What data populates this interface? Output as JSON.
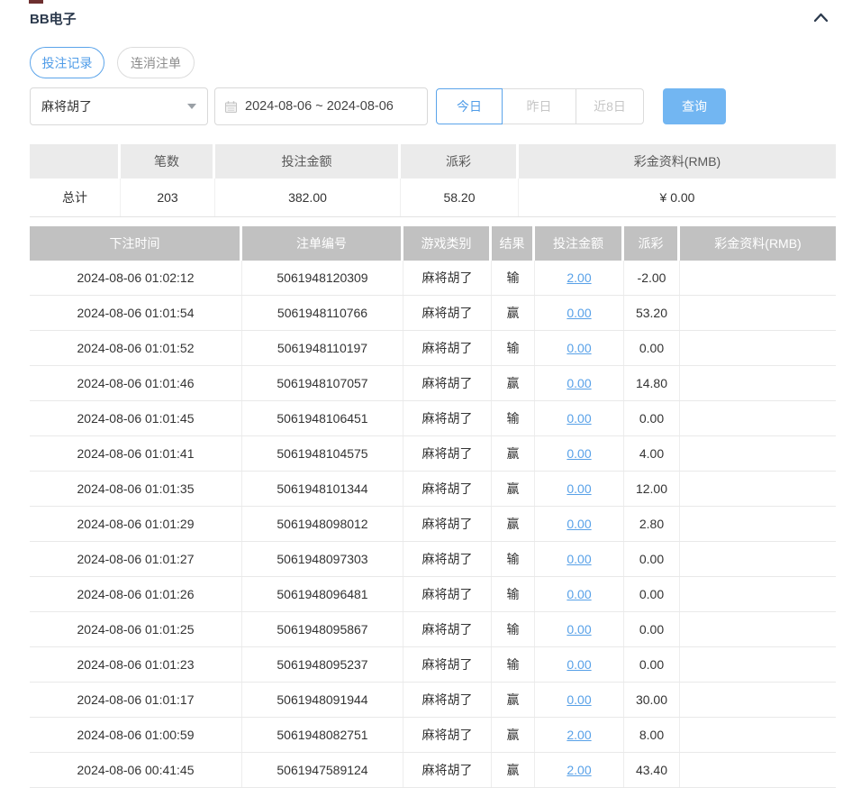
{
  "panel": {
    "title": "BB电子",
    "collapse_icon": "chevron-up"
  },
  "tabs": [
    {
      "label": "投注记录",
      "active": true
    },
    {
      "label": "连消注单",
      "active": false
    }
  ],
  "filters": {
    "game_select": {
      "value": "麻将胡了",
      "icon": "chevron-down-icon"
    },
    "date_range": {
      "value": "2024-08-06 ~ 2024-08-06",
      "icon": "calendar-icon"
    },
    "quick_buttons": [
      {
        "label": "今日",
        "active": true
      },
      {
        "label": "昨日",
        "active": false
      },
      {
        "label": "近8日",
        "active": false
      }
    ],
    "search_button": "查询"
  },
  "summary_table": {
    "headers": [
      "",
      "笔数",
      "投注金额",
      "派彩",
      "彩金资料(RMB)"
    ],
    "row": [
      "总计",
      "203",
      "382.00",
      "58.20",
      "¥ 0.00"
    ]
  },
  "main_table": {
    "headers": [
      "下注时间",
      "注单编号",
      "游戏类别",
      "结果",
      "投注金额",
      "派彩",
      "彩金资料(RMB)"
    ],
    "rows": [
      {
        "time": "2024-08-06 01:02:12",
        "order_no": "5061948120309",
        "game": "麻将胡了",
        "result": "输",
        "bet": "2.00",
        "payout": "-2.00",
        "bonus": ""
      },
      {
        "time": "2024-08-06 01:01:54",
        "order_no": "5061948110766",
        "game": "麻将胡了",
        "result": "赢",
        "bet": "0.00",
        "payout": "53.20",
        "bonus": ""
      },
      {
        "time": "2024-08-06 01:01:52",
        "order_no": "5061948110197",
        "game": "麻将胡了",
        "result": "输",
        "bet": "0.00",
        "payout": "0.00",
        "bonus": ""
      },
      {
        "time": "2024-08-06 01:01:46",
        "order_no": "5061948107057",
        "game": "麻将胡了",
        "result": "赢",
        "bet": "0.00",
        "payout": "14.80",
        "bonus": ""
      },
      {
        "time": "2024-08-06 01:01:45",
        "order_no": "5061948106451",
        "game": "麻将胡了",
        "result": "输",
        "bet": "0.00",
        "payout": "0.00",
        "bonus": ""
      },
      {
        "time": "2024-08-06 01:01:41",
        "order_no": "5061948104575",
        "game": "麻将胡了",
        "result": "赢",
        "bet": "0.00",
        "payout": "4.00",
        "bonus": ""
      },
      {
        "time": "2024-08-06 01:01:35",
        "order_no": "5061948101344",
        "game": "麻将胡了",
        "result": "赢",
        "bet": "0.00",
        "payout": "12.00",
        "bonus": ""
      },
      {
        "time": "2024-08-06 01:01:29",
        "order_no": "5061948098012",
        "game": "麻将胡了",
        "result": "赢",
        "bet": "0.00",
        "payout": "2.80",
        "bonus": ""
      },
      {
        "time": "2024-08-06 01:01:27",
        "order_no": "5061948097303",
        "game": "麻将胡了",
        "result": "输",
        "bet": "0.00",
        "payout": "0.00",
        "bonus": ""
      },
      {
        "time": "2024-08-06 01:01:26",
        "order_no": "5061948096481",
        "game": "麻将胡了",
        "result": "输",
        "bet": "0.00",
        "payout": "0.00",
        "bonus": ""
      },
      {
        "time": "2024-08-06 01:01:25",
        "order_no": "5061948095867",
        "game": "麻将胡了",
        "result": "输",
        "bet": "0.00",
        "payout": "0.00",
        "bonus": ""
      },
      {
        "time": "2024-08-06 01:01:23",
        "order_no": "5061948095237",
        "game": "麻将胡了",
        "result": "输",
        "bet": "0.00",
        "payout": "0.00",
        "bonus": ""
      },
      {
        "time": "2024-08-06 01:01:17",
        "order_no": "5061948091944",
        "game": "麻将胡了",
        "result": "赢",
        "bet": "0.00",
        "payout": "30.00",
        "bonus": ""
      },
      {
        "time": "2024-08-06 01:00:59",
        "order_no": "5061948082751",
        "game": "麻将胡了",
        "result": "赢",
        "bet": "2.00",
        "payout": "8.00",
        "bonus": ""
      },
      {
        "time": "2024-08-06 00:41:45",
        "order_no": "5061947589124",
        "game": "麻将胡了",
        "result": "赢",
        "bet": "2.00",
        "payout": "43.40",
        "bonus": ""
      }
    ]
  },
  "colors": {
    "accent_blue": "#5ba4ea",
    "search_button_blue": "#72b6f2",
    "negative_red": "#ee6b6b",
    "table_header_gray": "#c1c1c1",
    "summary_header_gray": "#ebebeb",
    "title_dark": "#2c3a4d"
  }
}
